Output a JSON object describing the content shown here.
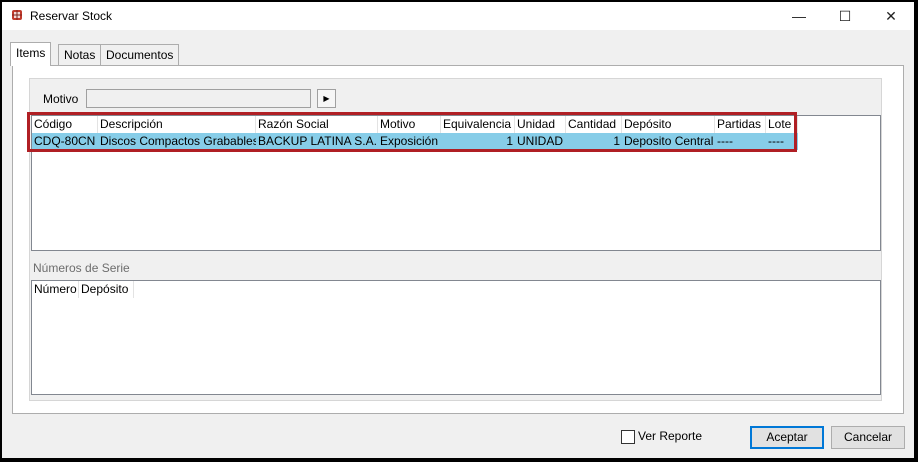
{
  "window": {
    "title": "Reservar Stock",
    "minimize": "—",
    "maximize": "☐",
    "close": "✕"
  },
  "tabs": [
    {
      "label": "Items"
    },
    {
      "label": "Notas"
    },
    {
      "label": "Documentos"
    }
  ],
  "motivo": {
    "label": "Motivo",
    "value": ""
  },
  "items_grid": {
    "headers": [
      "Código",
      "Descripción",
      "Razón Social",
      "Motivo",
      "Equivalencia",
      "Unidad",
      "Cantidad",
      "Depósito",
      "Partidas",
      "Lote"
    ],
    "rows": [
      [
        "CDQ-80CN",
        "Discos Compactos Grabables",
        "BACKUP LATINA S.A.",
        "Exposición",
        "1",
        "UNIDAD",
        "1",
        "Deposito Central",
        "----",
        "----"
      ]
    ]
  },
  "serie": {
    "label": "Números de Serie",
    "headers": [
      "Número",
      "Depósito"
    ]
  },
  "footer": {
    "ver_reporte": "Ver Reporte",
    "ver_reporte_checked": false,
    "aceptar": "Aceptar",
    "cancelar": "Cancelar"
  },
  "colors": {
    "selected_row": "#87cde8",
    "highlight_border": "#b01f24",
    "default_button_border": "#0078d7"
  }
}
